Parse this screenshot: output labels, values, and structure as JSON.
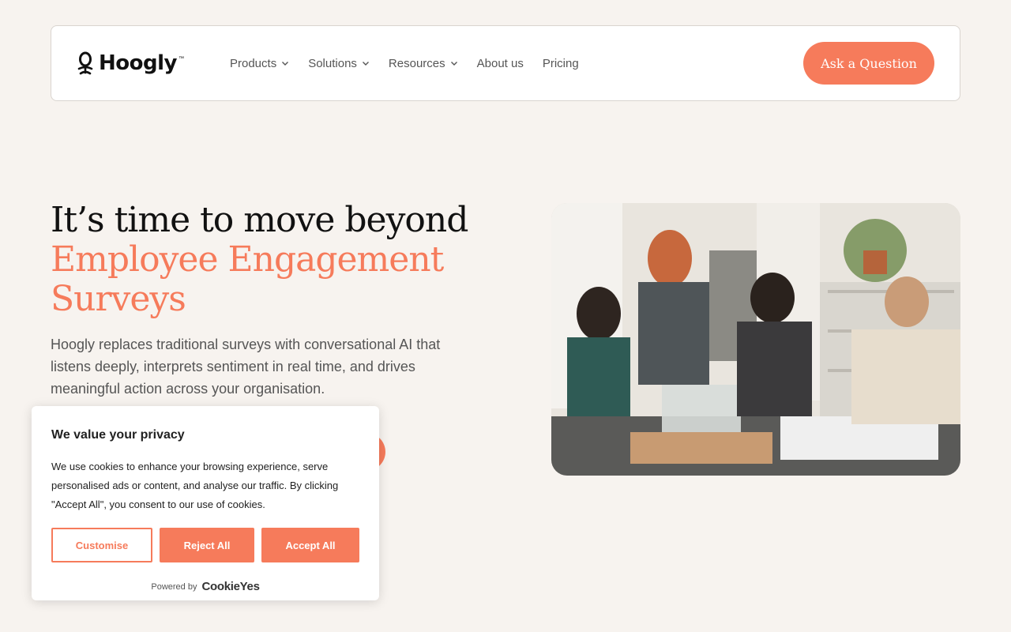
{
  "colors": {
    "accent": "#f67b5b",
    "background": "#f7f3ef",
    "text_dark": "#111111",
    "text_muted": "#555555"
  },
  "header": {
    "logo": {
      "text": "Hoogly",
      "tm": "™",
      "icon": "hoogly-logo-icon"
    },
    "nav": [
      {
        "label": "Products",
        "dropdown": true
      },
      {
        "label": "Solutions",
        "dropdown": true
      },
      {
        "label": "Resources",
        "dropdown": true
      },
      {
        "label": "About us",
        "dropdown": false
      },
      {
        "label": "Pricing",
        "dropdown": false
      }
    ],
    "cta_label": "Ask a Question"
  },
  "hero": {
    "title_line1": "It’s time to move beyond",
    "title_accent_line1": "Employee Engagement",
    "title_accent_line2": "Surveys",
    "description": "Hoogly replaces traditional surveys with conversational AI that listens deeply, interprets sentiment in real time, and drives meaningful action across your organisation."
  },
  "cookie_banner": {
    "title": "We value your privacy",
    "text": "We use cookies to enhance your browsing experience, serve personalised ads or content, and analyse our traffic. By clicking \"Accept All\", you consent to our use of cookies.",
    "customise_label": "Customise",
    "reject_label": "Reject All",
    "accept_label": "Accept All",
    "powered_by_label": "Powered by",
    "powered_by_brand": "CookieYes"
  }
}
